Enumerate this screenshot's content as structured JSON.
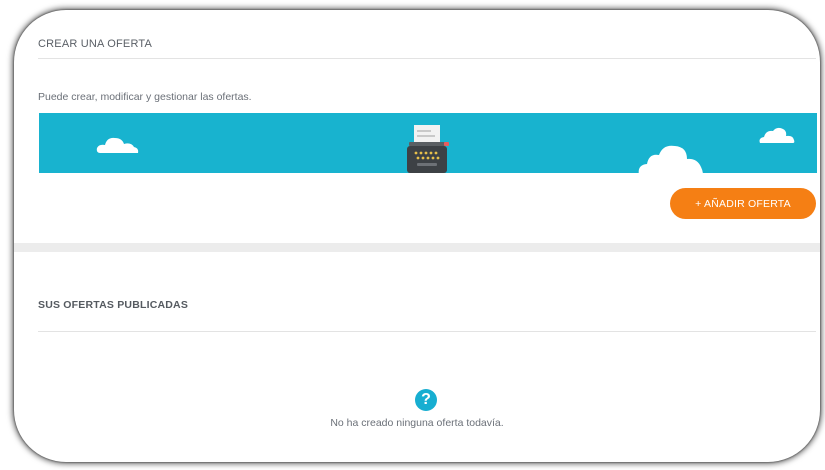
{
  "create_section": {
    "title": "CREAR UNA OFERTA",
    "subtitle": "Puede crear, modificar y gestionar las ofertas.",
    "add_button_label": "+ AÑADIR OFERTA"
  },
  "published_section": {
    "title": "SUS OFERTAS PUBLICADAS",
    "empty_icon_glyph": "?",
    "empty_message": "No ha creado ninguna oferta todavía."
  },
  "colors": {
    "banner": "#18b3cf",
    "accent_button": "#f57f14",
    "info_icon": "#17aed1"
  },
  "icons": {
    "banner_art": [
      "cloud-icon",
      "typewriter-icon",
      "cloud-icon",
      "cloud-icon"
    ],
    "empty_state": "question-circle-icon"
  }
}
